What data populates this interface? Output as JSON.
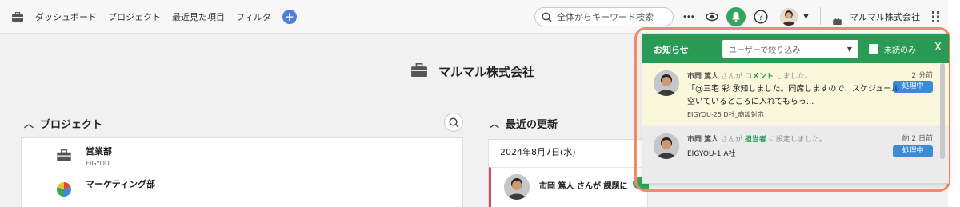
{
  "topbar": {
    "home_icon": "briefcase-icon",
    "nav": [
      "ダッシュボード",
      "プロジェクト",
      "最近見た項目",
      "フィルタ"
    ],
    "add_label": "+",
    "search_placeholder": "全体からキーワード検索",
    "more_label": "•••",
    "company": "マルマル株式会社"
  },
  "page": {
    "title": "マルマル株式会社",
    "projects_heading": "プロジェクト",
    "updates_heading": "最近の更新",
    "projects": [
      {
        "name": "営業部",
        "code": "EIGYOU"
      },
      {
        "name": "マーケティング部",
        "code": ""
      }
    ],
    "update_date": "2024年8月7日(水)",
    "update_entry": "市岡 篤人 さんが 課題に"
  },
  "notifications": {
    "title": "お知らせ",
    "user_filter_placeholder": "ユーザーで絞り込み",
    "unread_only_label": "未読のみ",
    "close_label": "X",
    "items": [
      {
        "user": "市岡 篤人",
        "suffix": "さんが",
        "action": "コメント",
        "tail": "しました。",
        "time": "2 分前",
        "badge": "処理中",
        "body": "「@三宅 彩 承知しました。同席しますので、スケジュール空いているところに入れてもらっ...",
        "issue": "EIGYOU-25 D社_商談対応"
      },
      {
        "user": "市岡 篤人",
        "suffix": "さんが",
        "action": "担当者",
        "tail": "に設定しました。",
        "time": "約 2 日前",
        "badge": "処理中",
        "issue": "EIGYOU-1 A社"
      }
    ]
  },
  "colors": {
    "brand_green": "#2a9b55",
    "badge_blue": "#3d8ad6",
    "highlight_outline": "#f08a6e",
    "unread_bg": "#fbf7dd",
    "add_button": "#4f7fd6"
  }
}
